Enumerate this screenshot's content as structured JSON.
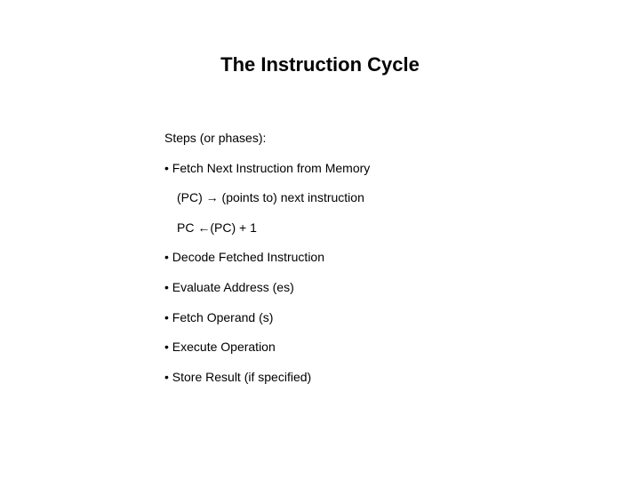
{
  "title": "The Instruction Cycle",
  "intro": "Steps (or phases):",
  "bullets": {
    "b1": "• Fetch Next Instruction from Memory",
    "b1_sub1_pre": "(PC) ",
    "b1_sub1_post": " (points to) next instruction",
    "b1_sub2_pre": "PC ",
    "b1_sub2_post": "(PC) + 1",
    "b2": "• Decode Fetched Instruction",
    "b3": "• Evaluate Address (es)",
    "b4": "• Fetch Operand (s)",
    "b5": "• Execute Operation",
    "b6": "• Store Result (if specified)"
  }
}
